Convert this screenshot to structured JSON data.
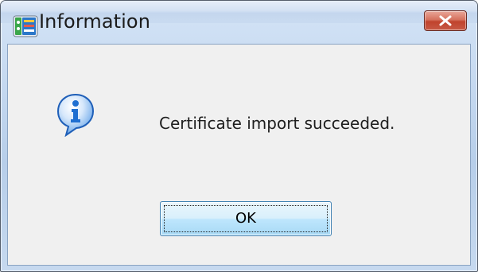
{
  "window": {
    "title": "Information",
    "icon": "certificate-app-icon",
    "close_icon": "close-icon"
  },
  "dialog": {
    "icon": "info-icon",
    "message": "Certificate import succeeded.",
    "ok_label": "OK"
  },
  "colors": {
    "close_button": "#c0432d",
    "info_icon_blue": "#1f6fd1",
    "ok_button_border": "#3c7fb1"
  }
}
